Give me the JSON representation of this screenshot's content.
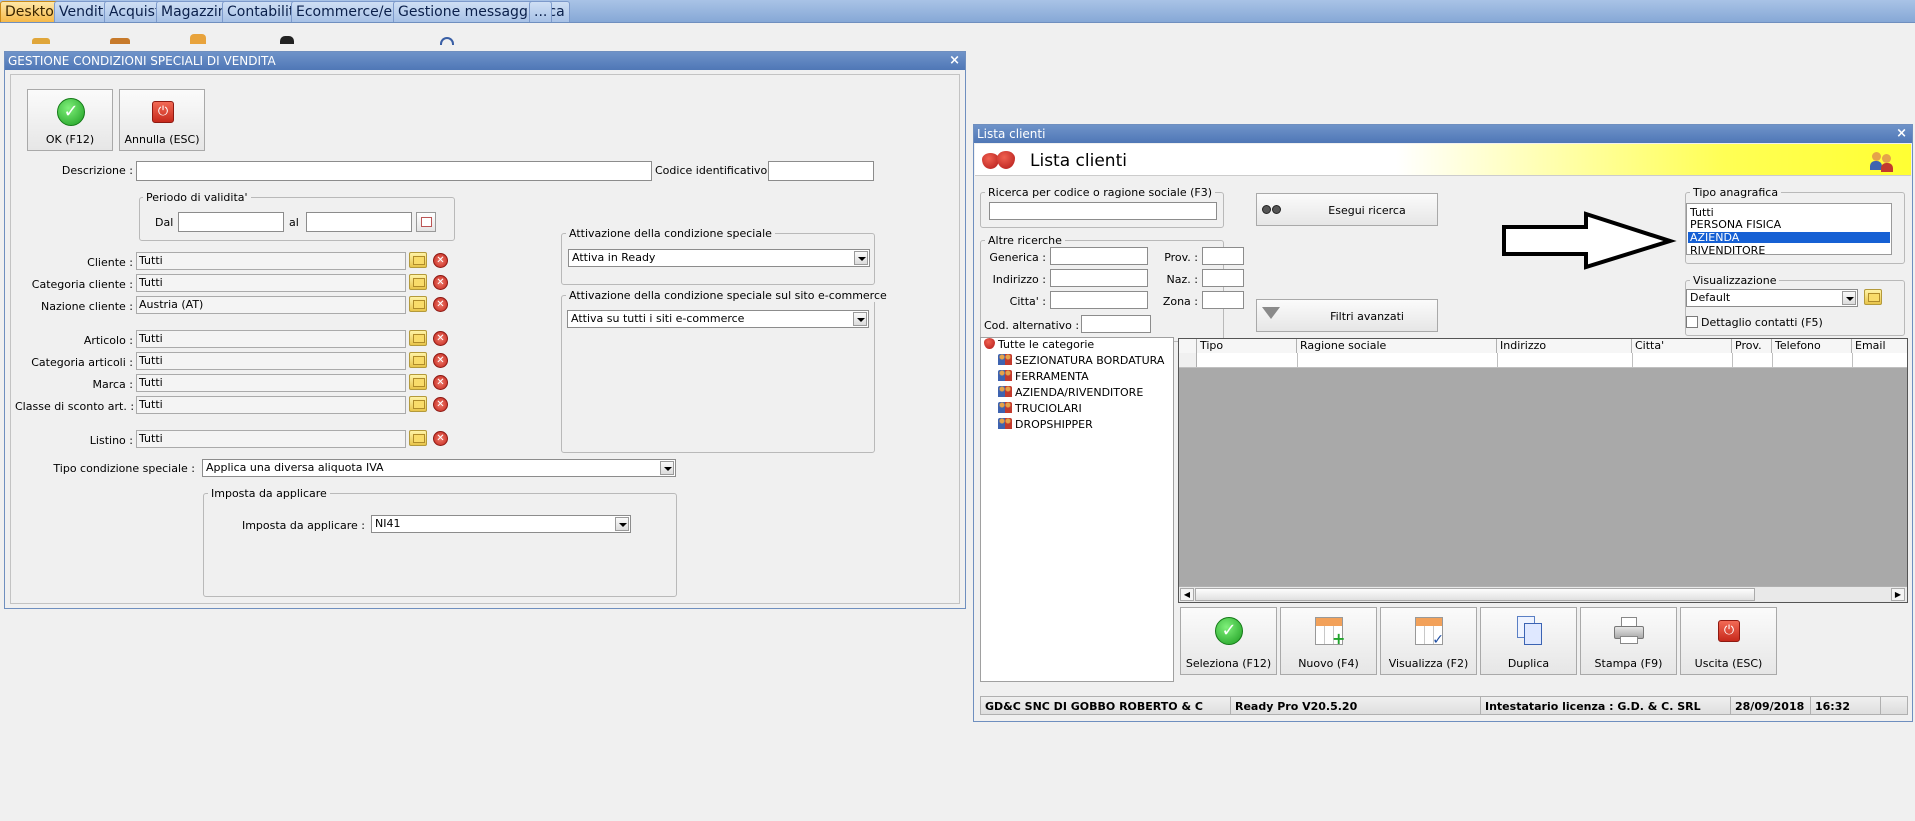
{
  "tabs": [
    "Desktop",
    "Vendite",
    "Acquisti",
    "Magazzino",
    "Contabilita'",
    "Ecommerce/eBay",
    "Gestione messaggistica",
    "..."
  ],
  "left_window": {
    "title": "GESTIONE CONDIZIONI SPECIALI DI VENDITA",
    "close": "×",
    "ok_label": "OK (F12)",
    "cancel_label": "Annulla (ESC)",
    "descrizione_label": "Descrizione :",
    "descrizione_value": "",
    "codice_label": "Codice identificativo :",
    "codice_value": "",
    "periodo_title": "Periodo di validita'",
    "dal_label": "Dal",
    "dal_value": "",
    "al_label": "al",
    "al_value": "",
    "fields": [
      {
        "label": "Cliente :",
        "value": "Tutti"
      },
      {
        "label": "Categoria cliente :",
        "value": "Tutti"
      },
      {
        "label": "Nazione cliente :",
        "value": "Austria (AT)"
      },
      {
        "label": "Articolo :",
        "value": "Tutti"
      },
      {
        "label": "Categoria articoli :",
        "value": "Tutti"
      },
      {
        "label": "Marca :",
        "value": "Tutti"
      },
      {
        "label": "Classe di sconto art. :",
        "value": "Tutti"
      },
      {
        "label": "Listino :",
        "value": "Tutti"
      }
    ],
    "attivazione_title": "Attivazione della condizione speciale",
    "attivazione_value": "Attiva in Ready",
    "attivazione_ecom_title": "Attivazione della condizione speciale sul sito e-commerce",
    "attivazione_ecom_value": "Attiva su tutti i siti e-commerce",
    "tipo_label": "Tipo condizione speciale :",
    "tipo_value": "Applica una diversa aliquota IVA",
    "imposta_group_title": "Imposta da applicare",
    "imposta_label": "Imposta da applicare :",
    "imposta_value": "NI41"
  },
  "right_window": {
    "title": "Lista clienti",
    "header_title": "Lista clienti",
    "close": "×",
    "ricerca_title": "Ricerca per codice o ragione sociale (F3)",
    "ricerca_value": "",
    "esegui_label": "Esegui ricerca",
    "altre_title": "Altre ricerche",
    "generica_label": "Generica :",
    "prov_label": "Prov. :",
    "indirizzo_label": "Indirizzo :",
    "naz_label": "Naz. :",
    "citta_label": "Citta' :",
    "zona_label": "Zona :",
    "cod_alt_label": "Cod. alternativo :",
    "filtri_label": "Filtri avanzati",
    "tipo_anagrafica_title": "Tipo anagrafica",
    "tipo_options": [
      "Tutti",
      "PERSONA FISICA",
      "AZIENDA",
      "RIVENDITORE"
    ],
    "tipo_selected_index": 2,
    "visualizzazione_title": "Visualizzazione",
    "visualizzazione_value": "Default",
    "dettaglio_label": "Dettaglio contatti (F5)",
    "dettaglio_checked": false,
    "tree_root": "Tutte le categorie",
    "tree_items": [
      "SEZIONATURA BORDATURA",
      "FERRAMENTA",
      "AZIENDA/RIVENDITORE",
      "TRUCIOLARI",
      "DROPSHIPPER"
    ],
    "grid_columns": [
      "Tipo",
      "Ragione sociale",
      "Indirizzo",
      "Citta'",
      "Prov.",
      "Telefono",
      "Email"
    ],
    "buttons": [
      "Seleziona (F12)",
      "Nuovo (F4)",
      "Visualizza (F2)",
      "Duplica",
      "Stampa (F9)",
      "Uscita (ESC)"
    ],
    "status": {
      "company": "GD&C SNC DI GOBBO ROBERTO & C",
      "version": "Ready Pro V20.5.20",
      "license": "Intestatario licenza : G.D. & C. SRL",
      "date": "28/09/2018",
      "time": "16:32"
    }
  },
  "colors": {
    "title_bar": "#4f77b6",
    "selection": "#1660d4",
    "header_yellow": "#ffff33",
    "grid_body": "#a9a9a9"
  }
}
